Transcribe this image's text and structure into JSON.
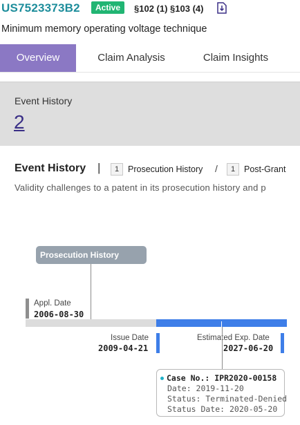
{
  "header": {
    "patent_number": "US7523373B2",
    "status": "Active",
    "statutes": "§102 (1) §103 (4)",
    "download_icon": "download-icon",
    "title": "Minimum memory operating voltage technique"
  },
  "tabs": [
    {
      "label": "Overview",
      "active": true
    },
    {
      "label": "Claim Analysis",
      "active": false
    },
    {
      "label": "Claim Insights",
      "active": false
    }
  ],
  "summary": {
    "label": "Event History",
    "count": "2"
  },
  "event_history": {
    "title": "Event History",
    "separator": "|",
    "prosecution_count": "1",
    "prosecution_label": "Prosecution History",
    "slash": "/",
    "post_grant_count": "1",
    "post_grant_label": "Post-Grant",
    "description": "Validity challenges to a patent in its prosecution history and p"
  },
  "timeline": {
    "prosecution_box": "Prosecution History",
    "appl_label": "Appl. Date",
    "appl_date": "2006-08-30",
    "issue_label": "Issue Date",
    "issue_date": "2009-04-21",
    "exp_label": "Estimated Exp. Date",
    "exp_date": "2027-06-20",
    "case": {
      "number": "Case No.: IPR2020-00158",
      "date": "Date: 2019-11-20",
      "status": "Status: Terminated-Denied",
      "status_date": "Status Date: 2020-05-20"
    }
  },
  "colors": {
    "brand_teal": "#1d8d9b",
    "active_green": "#21b573",
    "tab_active": "#8b78c4",
    "timeline_blue": "#3e7ee8",
    "case_dot": "#1fb0c7"
  }
}
